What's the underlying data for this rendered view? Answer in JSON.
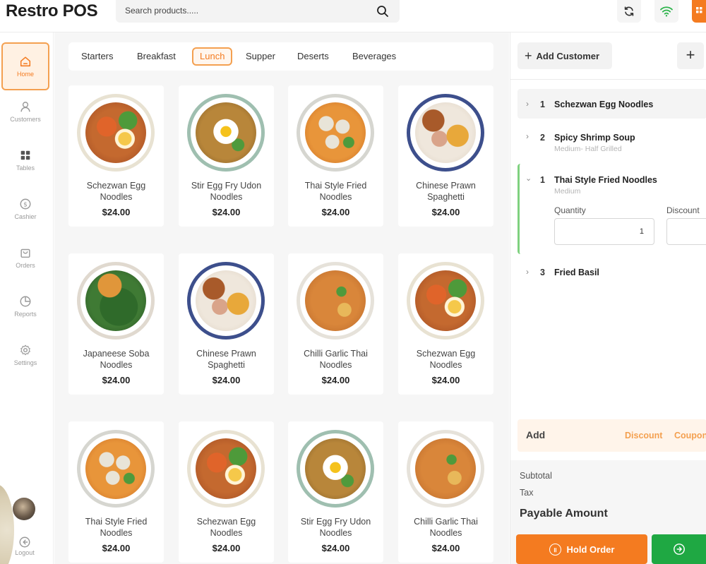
{
  "app": {
    "title": "Restro POS",
    "search_placeholder": "Search products.....",
    "accent_color": "#f47b20",
    "toolbar_icons": [
      "refresh-icon",
      "wifi-icon",
      "grid-icon"
    ]
  },
  "sidebar": {
    "items": [
      {
        "label": "Home",
        "icon": "home-icon",
        "active": true
      },
      {
        "label": "Customers",
        "icon": "user-icon",
        "active": false
      },
      {
        "label": "Tables",
        "icon": "grid-icon",
        "active": false
      },
      {
        "label": "Cashier",
        "icon": "dollar-icon",
        "active": false
      },
      {
        "label": "Orders",
        "icon": "bag-icon",
        "active": false
      },
      {
        "label": "Reports",
        "icon": "pie-chart-icon",
        "active": false
      },
      {
        "label": "Settings",
        "icon": "gear-icon",
        "active": false
      }
    ],
    "logout_label": "Logout"
  },
  "categories": {
    "items": [
      "Starters",
      "Breakfast",
      "Lunch",
      "Supper",
      "Deserts",
      "Beverages"
    ],
    "active": "Lunch"
  },
  "products": [
    {
      "name": "Schezwan Egg Noodles",
      "price": "$24.00",
      "dish": "egg-noodles"
    },
    {
      "name": "Stir Egg Fry Udon Noodles",
      "price": "$24.00",
      "dish": "fried-egg"
    },
    {
      "name": "Thai Style Fried Noodles",
      "price": "$24.00",
      "dish": "dumpling-curry"
    },
    {
      "name": "Chinese Prawn Spaghetti",
      "price": "$24.00",
      "dish": "prawn"
    },
    {
      "name": "Japaneese Soba Noodles",
      "price": "$24.00",
      "dish": "soba"
    },
    {
      "name": "Chinese Prawn Spaghetti",
      "price": "$24.00",
      "dish": "prawn"
    },
    {
      "name": "Chilli Garlic Thai Noodles",
      "price": "$24.00",
      "dish": "garlic-noodles"
    },
    {
      "name": "Schezwan Egg Noodles",
      "price": "$24.00",
      "dish": "egg-noodles"
    },
    {
      "name": "Thai Style Fried Noodles",
      "price": "$24.00",
      "dish": "dumpling-curry"
    },
    {
      "name": "Schezwan Egg Noodles",
      "price": "$24.00",
      "dish": "egg-noodles"
    },
    {
      "name": "Stir Egg Fry Udon Noodles",
      "price": "$24.00",
      "dish": "fried-egg"
    },
    {
      "name": "Chilli Garlic Thai Noodles",
      "price": "$24.00",
      "dish": "garlic-noodles"
    }
  ],
  "order": {
    "add_customer_label": "Add Customer",
    "add_button_label": "+",
    "items": [
      {
        "qty": "1",
        "name": "Schezwan Egg Noodles",
        "variant": "",
        "expanded": false
      },
      {
        "qty": "2",
        "name": "Spicy Shrimp Soup",
        "variant": "Medium- Half Grilled",
        "expanded": false
      },
      {
        "qty": "1",
        "name": "Thai Style Fried Noodles",
        "variant": "Medium",
        "expanded": true
      },
      {
        "qty": "3",
        "name": "Fried Basil",
        "variant": "",
        "expanded": false
      }
    ],
    "quantity_label": "Quantity",
    "quantity_value": "1",
    "discount_label": "Discount"
  },
  "actions": {
    "add_label": "Add",
    "discount_label": "Discount",
    "coupon_label": "Coupon"
  },
  "totals": {
    "subtotal_label": "Subtotal",
    "tax_label": "Tax",
    "payable_label": "Payable Amount"
  },
  "buttons": {
    "hold_label": "Hold Order"
  }
}
